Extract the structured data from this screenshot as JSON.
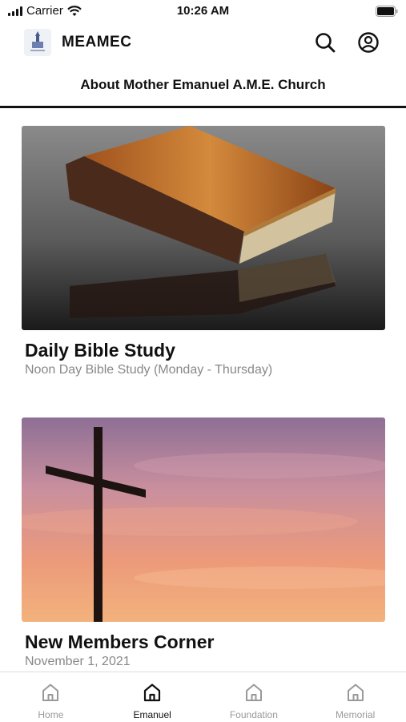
{
  "status_bar": {
    "carrier": "Carrier",
    "time": "10:26 AM"
  },
  "header": {
    "app_title": "MEAMEC"
  },
  "subnav": {
    "title": "About Mother Emanuel A.M.E. Church"
  },
  "cards": [
    {
      "title": "Daily Bible Study",
      "subtitle": "Noon Day Bible Study (Monday - Thursday)"
    },
    {
      "title": "New Members Corner",
      "subtitle": "November 1, 2021"
    }
  ],
  "tabs": [
    {
      "label": "Home",
      "active": false
    },
    {
      "label": "Emanuel",
      "active": true
    },
    {
      "label": "Foundation",
      "active": false
    },
    {
      "label": "Memorial",
      "active": false
    }
  ],
  "colors": {
    "accent": "#111111",
    "inactive": "#999999"
  }
}
